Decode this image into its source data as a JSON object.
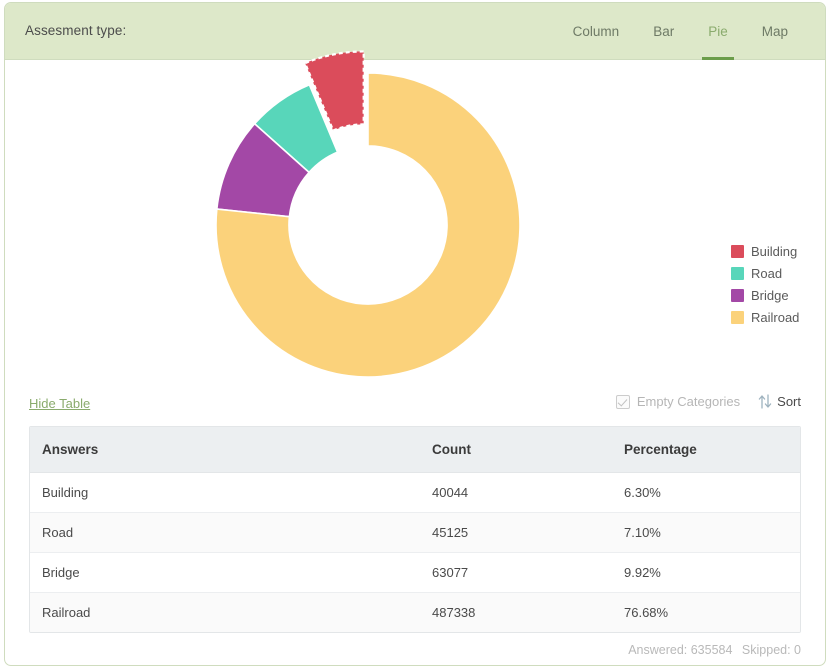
{
  "header": {
    "title": "Assesment type:",
    "tabs": [
      {
        "label": "Column",
        "active": false
      },
      {
        "label": "Bar",
        "active": false
      },
      {
        "label": "Pie",
        "active": true
      },
      {
        "label": "Map",
        "active": false
      }
    ],
    "background_color": "#dde8c9",
    "active_tab_color": "#6b9d4a"
  },
  "legend": [
    {
      "label": "Building",
      "color": "#db4c5b"
    },
    {
      "label": "Road",
      "color": "#58d6ba"
    },
    {
      "label": "Bridge",
      "color": "#a348a6"
    },
    {
      "label": "Railroad",
      "color": "#fbd27b"
    }
  ],
  "controls": {
    "hide_table_label": "Hide Table",
    "empty_categories_label": "Empty Categories",
    "empty_categories_checked": true,
    "sort_label": "Sort",
    "sort_icon": "sort-updown-icon"
  },
  "table": {
    "columns": [
      "Answers",
      "Count",
      "Percentage"
    ],
    "rows": [
      {
        "answer": "Building",
        "count": "40044",
        "percentage": "6.30%"
      },
      {
        "answer": "Road",
        "count": "45125",
        "percentage": "7.10%"
      },
      {
        "answer": "Bridge",
        "count": "63077",
        "percentage": "9.92%"
      },
      {
        "answer": "Railroad",
        "count": "487338",
        "percentage": "76.68%"
      }
    ]
  },
  "footer": {
    "answered": "Answered: 635584",
    "skipped": "Skipped: 0"
  },
  "chart_data": {
    "type": "pie",
    "variant": "donut",
    "title": "",
    "categories": [
      "Building",
      "Road",
      "Bridge",
      "Railroad"
    ],
    "values": [
      40044,
      45125,
      63077,
      487338
    ],
    "percentages": [
      6.3,
      7.1,
      9.92,
      76.68
    ],
    "colors": [
      "#db4c5b",
      "#58d6ba",
      "#a348a6",
      "#fbd27b"
    ],
    "total": 635584,
    "inner_radius_ratio": 0.52,
    "start_angle_deg": -90,
    "direction": "counterclockwise",
    "exploded_slices": [
      "Building"
    ],
    "selected_slice": "Building",
    "selected_slice_outline": "dashed-white",
    "legend_position": "right",
    "grid": false
  }
}
